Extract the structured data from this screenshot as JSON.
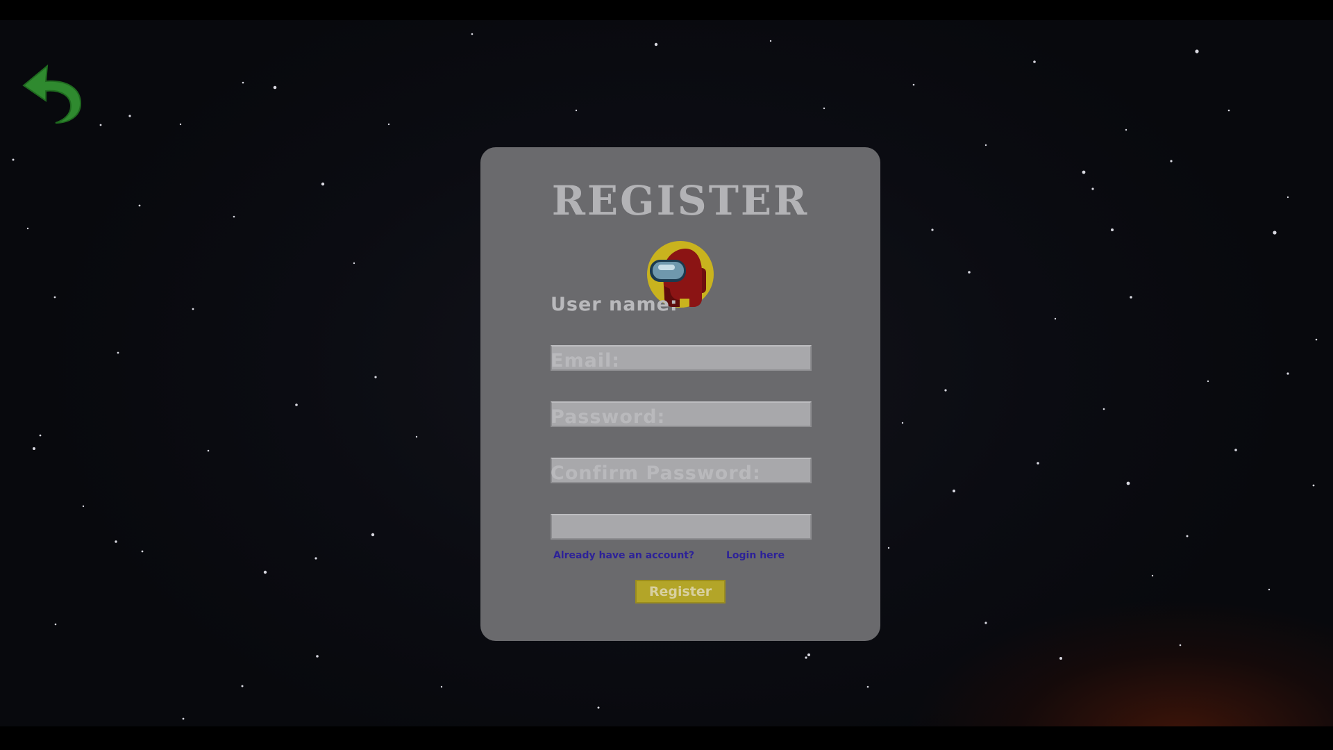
{
  "colors": {
    "card_background": "#6a6a6d",
    "title": "#b3b3b6",
    "label": "#b9b9bc",
    "input_background": "#a8a8ab",
    "link": "#2d2298",
    "register_button": "#b3a528",
    "back_icon": "#2f8a2f",
    "avatar_ring": "#c9b31e",
    "crewmate": "#8b1414"
  },
  "nav": {
    "back_icon": "back-arrow-icon"
  },
  "form": {
    "title": "REGISTER",
    "avatar_icon": "red-crewmate-icon",
    "username_label": "User name:",
    "username_value": "",
    "email_label": "Email:",
    "email_value": "",
    "password_label": "Password:",
    "password_value": "",
    "confirm_password_label": "Confirm Password:",
    "confirm_password_value": "",
    "already_have_account": "Already have an account?",
    "login_link": "Login here",
    "register_button": "Register"
  }
}
